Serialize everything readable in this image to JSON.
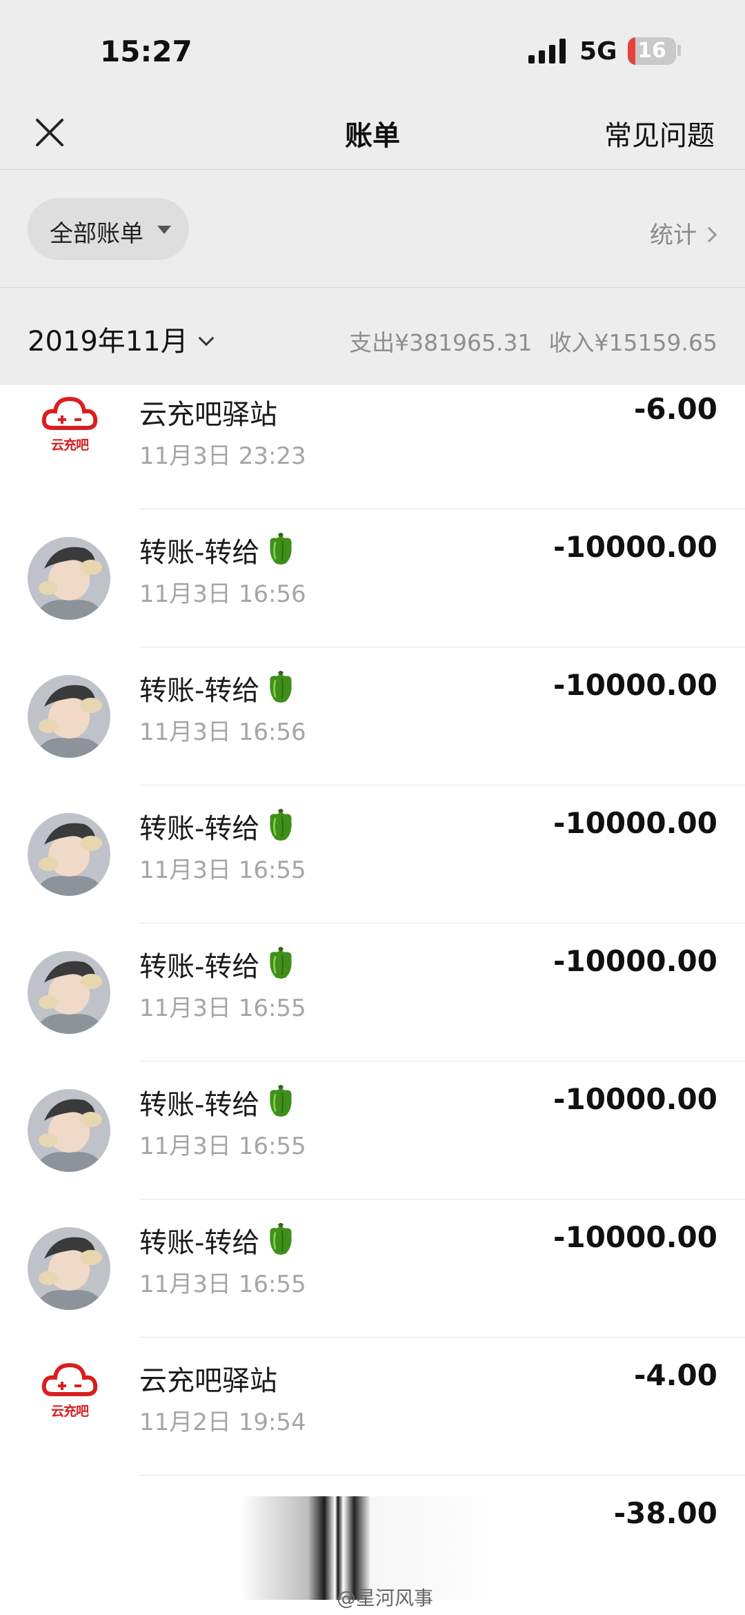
{
  "status_bar": {
    "time": "15:27",
    "network": "5G",
    "battery": "16",
    "battery_level": 0.16
  },
  "nav": {
    "title": "账单",
    "faq": "常见问题"
  },
  "filter": {
    "label": "全部账单",
    "stats": "统计"
  },
  "month": {
    "label": "2019年11月",
    "expense": "支出¥381965.31",
    "income": "收入¥15159.65"
  },
  "merchant_logo_text": "云充吧",
  "bills": [
    {
      "title": "云充吧驿站",
      "time": "11月3日 23:23",
      "amount": "-6.00",
      "icon": "yunchongba-logo"
    },
    {
      "title": "转账-转给",
      "time": "11月3日 16:56",
      "amount": "-10000.00",
      "icon": "pepper-icon"
    },
    {
      "title": "转账-转给",
      "time": "11月3日 16:56",
      "amount": "-10000.00",
      "icon": "pepper-icon"
    },
    {
      "title": "转账-转给",
      "time": "11月3日 16:55",
      "amount": "-10000.00",
      "icon": "pepper-icon"
    },
    {
      "title": "转账-转给",
      "time": "11月3日 16:55",
      "amount": "-10000.00",
      "icon": "pepper-icon"
    },
    {
      "title": "转账-转给",
      "time": "11月3日 16:55",
      "amount": "-10000.00",
      "icon": "pepper-icon"
    },
    {
      "title": "转账-转给",
      "time": "11月3日 16:55",
      "amount": "-10000.00",
      "icon": "pepper-icon"
    },
    {
      "title": "云充吧驿站",
      "time": "11月2日 19:54",
      "amount": "-4.00",
      "icon": "yunchongba-logo"
    },
    {
      "title": "",
      "time": "",
      "amount": "-38.00",
      "icon": ""
    }
  ],
  "watermark": "@星河风事",
  "colors": {
    "brand_red": "#d81e1e",
    "background": "#ededed",
    "amount_text": "#111111",
    "muted_text": "#a5a5a5"
  }
}
